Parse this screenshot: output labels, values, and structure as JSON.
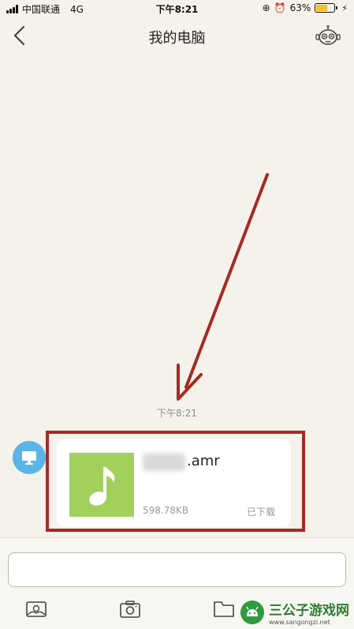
{
  "status_bar": {
    "carrier": "中国联通",
    "network": "4G",
    "time": "下午8:21",
    "battery": "63%",
    "battery_level": 0.63
  },
  "nav": {
    "title": "我的电脑",
    "back_icon": "chevron-left-icon",
    "right_icon": "robot-icon"
  },
  "chat": {
    "timestamp": "下午8:21",
    "avatar_icon": "computer-icon",
    "file": {
      "name": ".amr",
      "size": "598.78KB",
      "status": "已下载",
      "type_icon": "music-note-icon",
      "thumb_color": "#a3d05c"
    }
  },
  "annotation_color": "#a52a25",
  "toolbar": {
    "icons": [
      "image-icon",
      "camera-icon",
      "folder-icon"
    ]
  },
  "watermark": {
    "main": "三公子游戏网",
    "sub": "www.sangongzi.net"
  }
}
